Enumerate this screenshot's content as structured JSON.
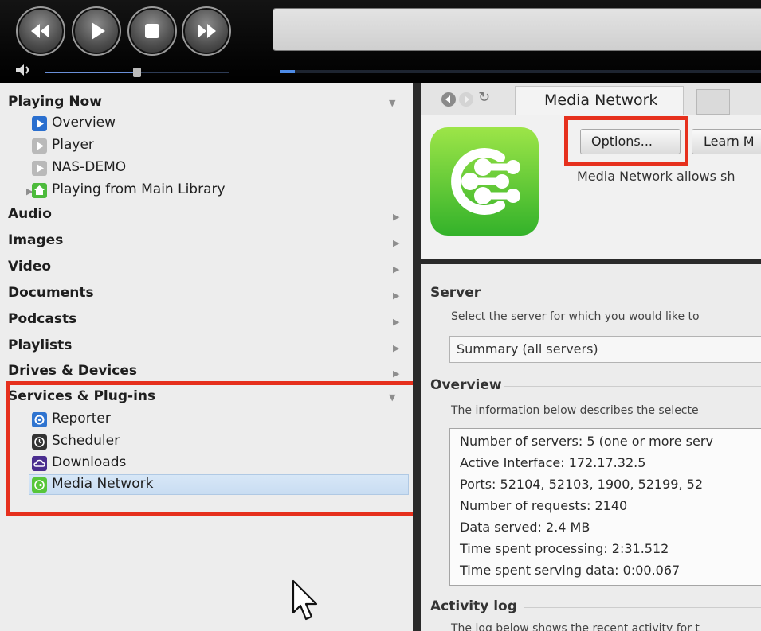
{
  "toolbar": {
    "buttons": [
      "rewind-icon",
      "play-icon",
      "stop-icon",
      "fast-forward-icon"
    ],
    "volume_level": 0.5,
    "progress_level": 0.03
  },
  "tree": {
    "playing_now": {
      "label": "Playing Now",
      "items": [
        {
          "label": "Overview",
          "icon": "overview-icon"
        },
        {
          "label": "Player",
          "icon": "player-icon"
        },
        {
          "label": "NAS-DEMO",
          "icon": "nas-icon"
        },
        {
          "label": "Playing from Main Library",
          "icon": "library-home-icon"
        }
      ]
    },
    "categories": [
      "Audio",
      "Images",
      "Video",
      "Documents",
      "Podcasts",
      "Playlists",
      "Drives & Devices"
    ],
    "services": {
      "label": "Services & Plug-ins",
      "items": [
        {
          "label": "Reporter",
          "icon": "reporter-icon"
        },
        {
          "label": "Scheduler",
          "icon": "scheduler-icon"
        },
        {
          "label": "Downloads",
          "icon": "downloads-icon"
        },
        {
          "label": "Media Network",
          "icon": "media-network-icon"
        }
      ],
      "selected": "Media Network"
    }
  },
  "right": {
    "tab_title": "Media Network",
    "options_button": "Options...",
    "learn_more_button": "Learn M",
    "hero_text": "Media Network allows sh",
    "server": {
      "heading": "Server",
      "description": "Select the server for which you would like to",
      "selected_value": "Summary (all servers)"
    },
    "overview": {
      "heading": "Overview",
      "description": "The information below describes the selecte",
      "lines": [
        "Number of servers: 5 (one or more serv",
        "Active Interface: 172.17.32.5",
        "Ports: 52104, 52103, 1900, 52199, 52",
        "Number of requests: 2140",
        "Data served: 2.4 MB",
        "Time spent processing: 2:31.512",
        "Time spent serving data: 0:00.067"
      ]
    },
    "activity_log": {
      "heading": "Activity log",
      "description": "The log below shows the recent activity for t"
    }
  },
  "colors": {
    "highlight_box": "#e6301d",
    "selection": "#d7e7f7",
    "logo_green": "#5ccc34"
  }
}
